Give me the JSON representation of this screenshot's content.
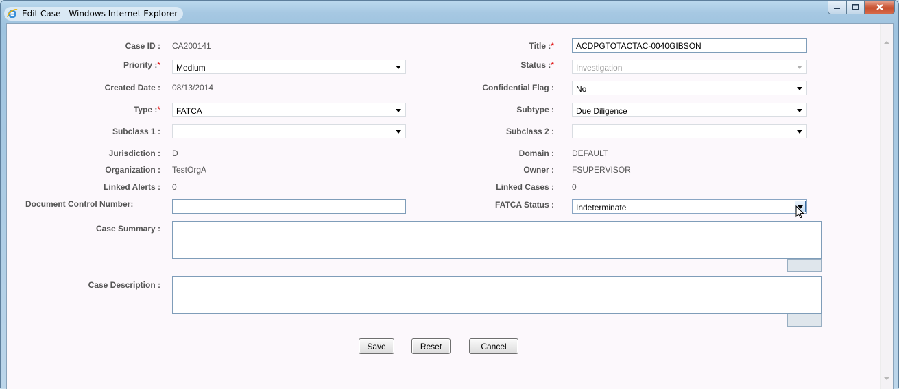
{
  "window": {
    "title": "Edit Case - Windows Internet Explorer"
  },
  "form": {
    "case_id": {
      "label": "Case ID :",
      "value": "CA200141"
    },
    "title": {
      "label": "Title :",
      "required": "*",
      "value": "ACDPGTOTACTAC-0040GIBSON"
    },
    "priority": {
      "label": "Priority :",
      "required": "*",
      "value": "Medium"
    },
    "status": {
      "label": "Status :",
      "required": "*",
      "value": "Investigation"
    },
    "created_date": {
      "label": "Created Date :",
      "value": "08/13/2014"
    },
    "confidential_flag": {
      "label": "Confidential Flag :",
      "value": "No"
    },
    "type": {
      "label": "Type :",
      "required": "*",
      "value": "FATCA"
    },
    "subtype": {
      "label": "Subtype :",
      "value": "Due Diligence"
    },
    "subclass1": {
      "label": "Subclass 1 :",
      "value": ""
    },
    "subclass2": {
      "label": "Subclass 2 :",
      "value": ""
    },
    "jurisdiction": {
      "label": "Jurisdiction :",
      "value": "D"
    },
    "domain": {
      "label": "Domain :",
      "value": "DEFAULT"
    },
    "organization": {
      "label": "Organization :",
      "value": "TestOrgA"
    },
    "owner": {
      "label": "Owner :",
      "value": "FSUPERVISOR"
    },
    "linked_alerts": {
      "label": "Linked Alerts :",
      "value": "0"
    },
    "linked_cases": {
      "label": "Linked Cases :",
      "value": "0"
    },
    "document_control_number": {
      "label": "Document Control Number:",
      "value": ""
    },
    "fatca_status": {
      "label": "FATCA Status :",
      "value": "Indeterminate"
    },
    "case_summary": {
      "label": "Case Summary :",
      "value": ""
    },
    "case_description": {
      "label": "Case Description :",
      "value": ""
    }
  },
  "buttons": {
    "save": "Save",
    "reset": "Reset",
    "cancel": "Cancel"
  },
  "icons": {
    "browser": "internet-explorer-icon",
    "cursor": "mouse-pointer-icon"
  },
  "colors": {
    "required": "#dd0000",
    "label": "#555555",
    "background": "#fcf8fc",
    "close": "#c7502f"
  }
}
